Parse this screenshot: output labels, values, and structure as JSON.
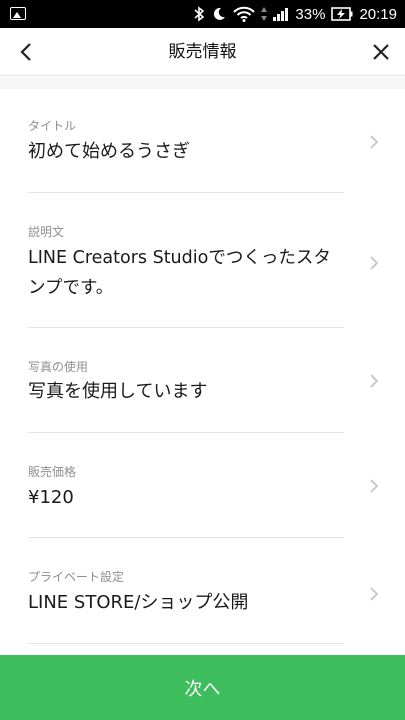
{
  "status_bar": {
    "battery": "33%",
    "time": "20:19"
  },
  "header": {
    "title": "販売情報"
  },
  "items": [
    {
      "label": "タイトル",
      "value": "初めて始めるうさぎ"
    },
    {
      "label": "説明文",
      "value_lines": [
        "LINE Creators Studioでつくったスタ",
        "ンプです。"
      ]
    },
    {
      "label": "写真の使用",
      "value": "写真を使用しています"
    },
    {
      "label": "販売価格",
      "value": "¥120"
    },
    {
      "label": "プライベート設定",
      "value": "LINE STORE/ショップ公開"
    }
  ],
  "footer": {
    "next_label": "次へ"
  },
  "colors": {
    "accent": "#3dbd5b"
  }
}
